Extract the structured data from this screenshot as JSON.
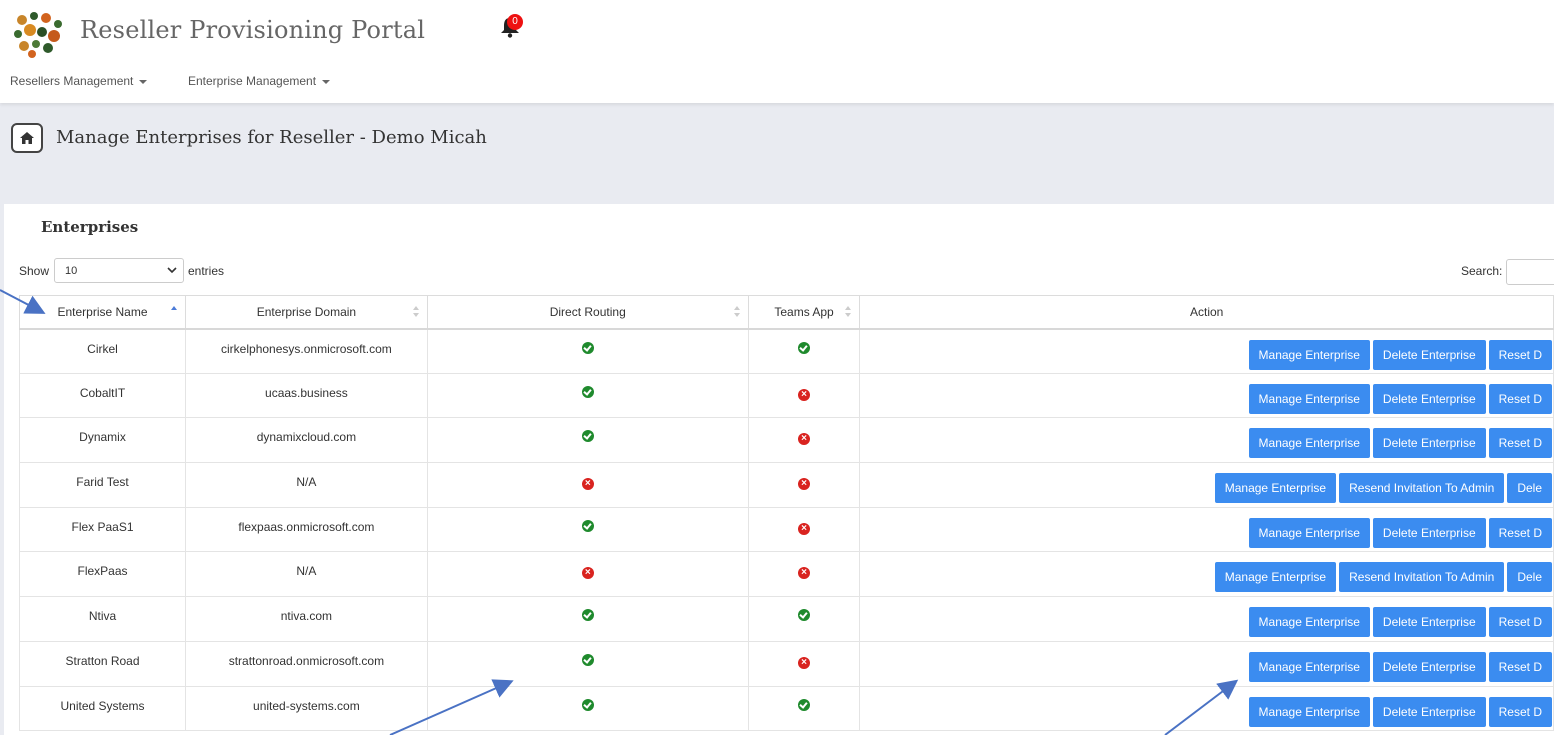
{
  "header": {
    "app_title": "Reseller Provisioning Portal",
    "notification_count": "0",
    "nav": [
      {
        "label": "Resellers Management"
      },
      {
        "label": "Enterprise Management"
      }
    ]
  },
  "page": {
    "title": "Manage Enterprises for Reseller - Demo Micah"
  },
  "panel": {
    "title": "Enterprises",
    "show_label": "Show",
    "page_length": "10",
    "entries_label": "entries",
    "search_label": "Search:",
    "search_value": ""
  },
  "table": {
    "columns": [
      "Enterprise Name",
      "Enterprise Domain",
      "Direct Routing",
      "Teams App",
      "Action"
    ],
    "sort_column": "Enterprise Name",
    "rows": [
      {
        "name": "Cirkel",
        "domain": "cirkelphonesys.onmicrosoft.com",
        "direct_routing": true,
        "teams_app": true,
        "actions": [
          "Manage Enterprise",
          "Delete Enterprise",
          "Reset D"
        ]
      },
      {
        "name": "CobaltIT",
        "domain": "ucaas.business",
        "direct_routing": true,
        "teams_app": false,
        "actions": [
          "Manage Enterprise",
          "Delete Enterprise",
          "Reset D"
        ]
      },
      {
        "name": "Dynamix",
        "domain": "dynamixcloud.com",
        "direct_routing": true,
        "teams_app": false,
        "actions": [
          "Manage Enterprise",
          "Delete Enterprise",
          "Reset D"
        ]
      },
      {
        "name": "Farid Test",
        "domain": "N/A",
        "direct_routing": false,
        "teams_app": false,
        "actions": [
          "Manage Enterprise",
          "Resend Invitation To Admin",
          "Dele"
        ]
      },
      {
        "name": "Flex PaaS1",
        "domain": "flexpaas.onmicrosoft.com",
        "direct_routing": true,
        "teams_app": false,
        "actions": [
          "Manage Enterprise",
          "Delete Enterprise",
          "Reset D"
        ]
      },
      {
        "name": "FlexPaas",
        "domain": "N/A",
        "direct_routing": false,
        "teams_app": false,
        "actions": [
          "Manage Enterprise",
          "Resend Invitation To Admin",
          "Dele"
        ]
      },
      {
        "name": "Ntiva",
        "domain": "ntiva.com",
        "direct_routing": true,
        "teams_app": true,
        "actions": [
          "Manage Enterprise",
          "Delete Enterprise",
          "Reset D"
        ]
      },
      {
        "name": "Stratton Road",
        "domain": "strattonroad.onmicrosoft.com",
        "direct_routing": true,
        "teams_app": false,
        "actions": [
          "Manage Enterprise",
          "Delete Enterprise",
          "Reset D"
        ]
      },
      {
        "name": "United Systems",
        "domain": "united-systems.com",
        "direct_routing": true,
        "teams_app": true,
        "actions": [
          "Manage Enterprise",
          "Delete Enterprise",
          "Reset D"
        ]
      }
    ]
  },
  "colors": {
    "button_blue": "#3b8cf0",
    "status_yes": "#1f8a2d",
    "status_no": "#d9231f",
    "annotation_arrow": "#4a72c4"
  }
}
